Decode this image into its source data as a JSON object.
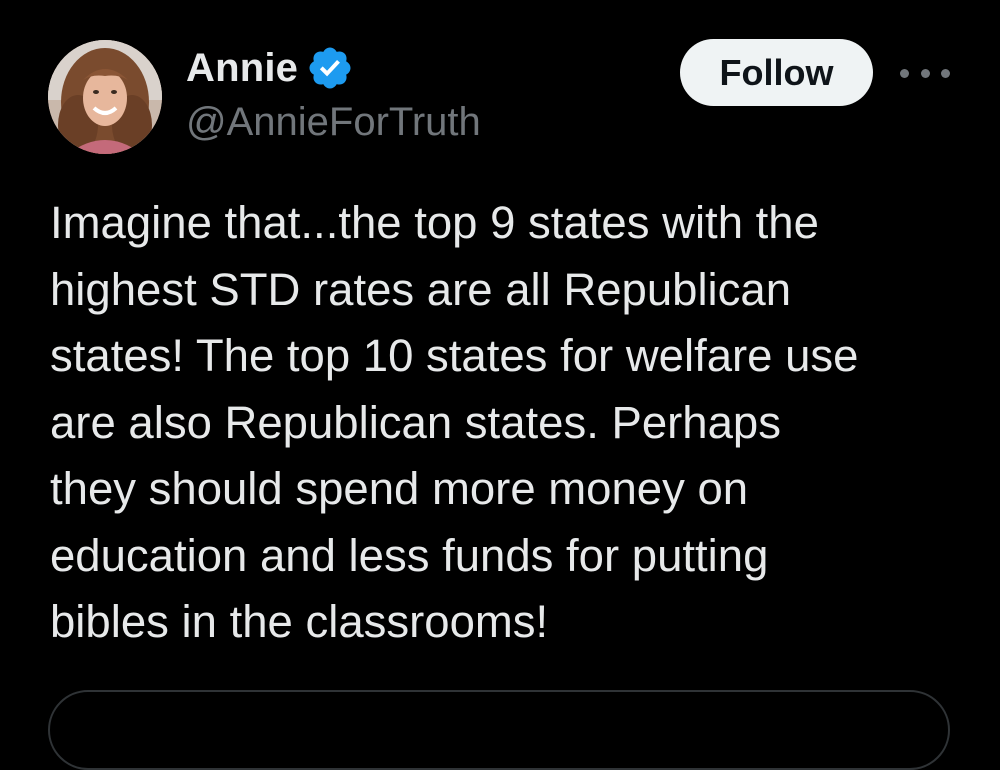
{
  "author": {
    "display_name": "Annie",
    "handle": "@AnnieForTruth",
    "avatar_icon": "profile-photo",
    "verified_icon": "verified-badge-icon"
  },
  "actions": {
    "follow_label": "Follow",
    "more_icon": "more-options-icon"
  },
  "tweet": {
    "text": "Imagine that...the top 9 states with the\nhighest STD rates are all Republican\nstates! The top 10 states for welfare use\nare also Republican states. Perhaps\nthey should spend more money on\neducation and less funds for putting\nbibles in the classrooms!"
  },
  "colors": {
    "background": "#000000",
    "text": "#e7e9ea",
    "secondary_text": "#71767b",
    "verified_blue": "#1d9bf0",
    "follow_bg": "#eff3f4",
    "border": "#2f3336"
  }
}
